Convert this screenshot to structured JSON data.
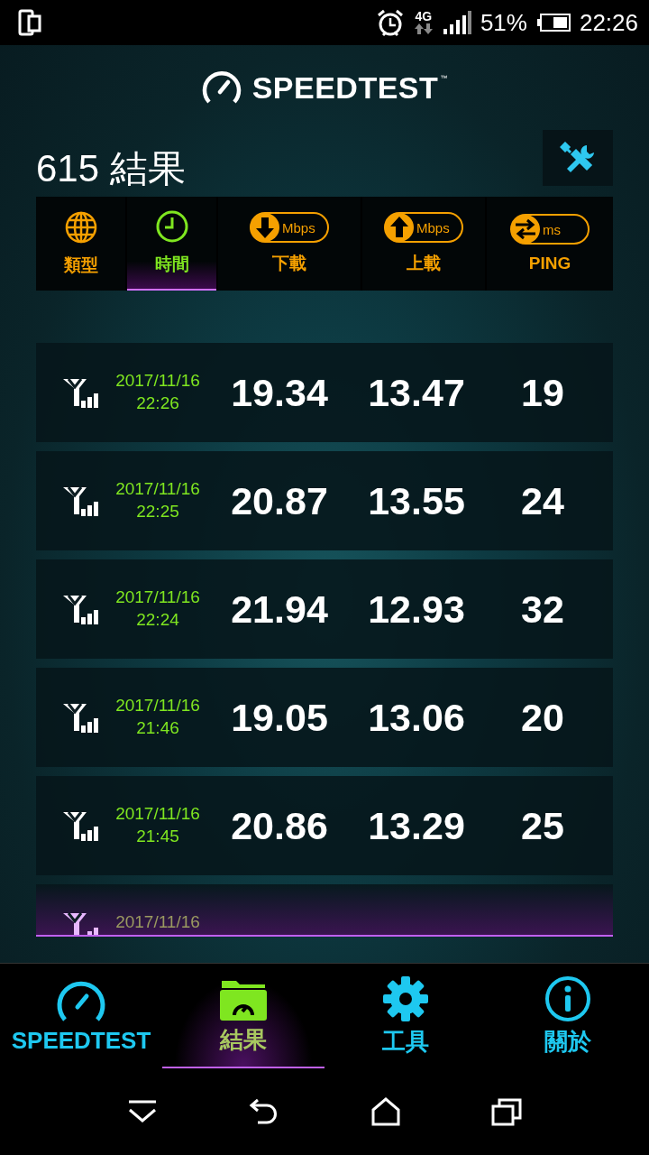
{
  "status_bar": {
    "network": "4G",
    "battery": "51%",
    "time": "22:26"
  },
  "app_title": "SPEEDTEST",
  "trademark": "™",
  "result_count": "615 結果",
  "sort_tabs": [
    {
      "kind": "type",
      "label": "類型",
      "selected": false
    },
    {
      "kind": "time",
      "label": "時間",
      "selected": true
    },
    {
      "kind": "download",
      "unit": "Mbps",
      "label": "下載",
      "selected": false
    },
    {
      "kind": "upload",
      "unit": "Mbps",
      "label": "上載",
      "selected": false
    },
    {
      "kind": "ping",
      "unit": "ms",
      "label": "PING",
      "selected": false
    }
  ],
  "results": [
    {
      "date": "2017/11/16",
      "time": "22:26",
      "download": "19.34",
      "upload": "13.47",
      "ping": "19"
    },
    {
      "date": "2017/11/16",
      "time": "22:25",
      "download": "20.87",
      "upload": "13.55",
      "ping": "24"
    },
    {
      "date": "2017/11/16",
      "time": "22:24",
      "download": "21.94",
      "upload": "12.93",
      "ping": "32"
    },
    {
      "date": "2017/11/16",
      "time": "21:46",
      "download": "19.05",
      "upload": "13.06",
      "ping": "20"
    },
    {
      "date": "2017/11/16",
      "time": "21:45",
      "download": "20.86",
      "upload": "13.29",
      "ping": "25"
    },
    {
      "date": "2017/11/16"
    }
  ],
  "bottom_nav": [
    {
      "kind": "speedtest",
      "label": "SPEEDTEST",
      "selected": false
    },
    {
      "kind": "results",
      "label": "結果",
      "selected": true
    },
    {
      "kind": "tools",
      "label": "工具",
      "selected": false
    },
    {
      "kind": "about",
      "label": "關於",
      "selected": false
    }
  ]
}
